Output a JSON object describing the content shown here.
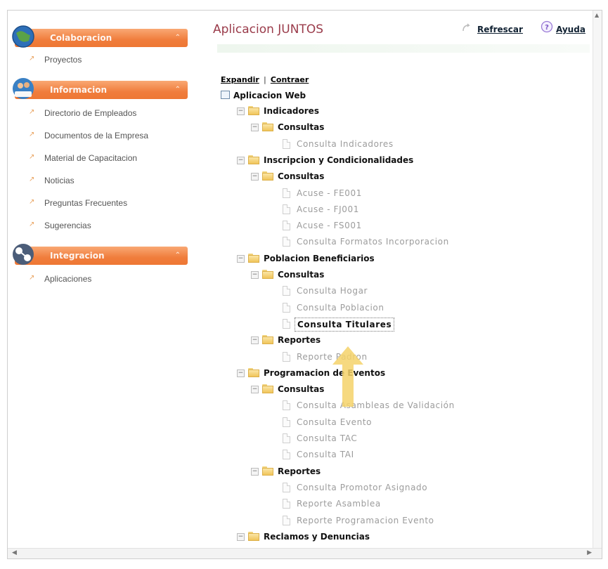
{
  "sidebar": {
    "sections": [
      {
        "label": "Colaboracion",
        "items": [
          "Proyectos"
        ]
      },
      {
        "label": "Informacion",
        "items": [
          "Directorio de Empleados",
          "Documentos de la Empresa",
          "Material de Capacitacion",
          "Noticias",
          "Preguntas Frecuentes",
          "Sugerencias"
        ]
      },
      {
        "label": "Integracion",
        "items": [
          "Aplicaciones"
        ]
      }
    ],
    "chevron": "⌃"
  },
  "header": {
    "title": "Aplicacion JUNTOS",
    "refresh_label": "Refrescar",
    "help_label": "Ayuda"
  },
  "tree_controls": {
    "expand_label": "Expandir",
    "separator": "|",
    "collapse_label": "Contraer"
  },
  "tree": {
    "root": "Aplicacion Web",
    "rows": [
      {
        "type": "folder",
        "level": 1,
        "label": "Indicadores"
      },
      {
        "type": "folder",
        "level": 2,
        "label": "Consultas"
      },
      {
        "type": "leaf",
        "level": 3,
        "label": "Consulta Indicadores"
      },
      {
        "type": "folder",
        "level": 1,
        "label": "Inscripcion y Condicionalidades"
      },
      {
        "type": "folder",
        "level": 2,
        "label": "Consultas"
      },
      {
        "type": "leaf",
        "level": 3,
        "label": "Acuse - FE001"
      },
      {
        "type": "leaf",
        "level": 3,
        "label": "Acuse - FJ001"
      },
      {
        "type": "leaf",
        "level": 3,
        "label": "Acuse - FS001"
      },
      {
        "type": "leaf",
        "level": 3,
        "label": "Consulta Formatos Incorporacion"
      },
      {
        "type": "folder",
        "level": 1,
        "label": "Poblacion Beneficiarios"
      },
      {
        "type": "folder",
        "level": 2,
        "label": "Consultas"
      },
      {
        "type": "leaf",
        "level": 3,
        "label": "Consulta Hogar"
      },
      {
        "type": "leaf",
        "level": 3,
        "label": "Consulta Poblacion"
      },
      {
        "type": "leaf",
        "level": 3,
        "label": "Consulta Titulares",
        "selected": true
      },
      {
        "type": "folder",
        "level": 2,
        "label": "Reportes"
      },
      {
        "type": "leaf",
        "level": 3,
        "label": "Reporte Padron"
      },
      {
        "type": "folder",
        "level": 1,
        "label": "Programacion de Eventos"
      },
      {
        "type": "folder",
        "level": 2,
        "label": "Consultas"
      },
      {
        "type": "leaf",
        "level": 3,
        "label": "Consulta Asambleas de Validación"
      },
      {
        "type": "leaf",
        "level": 3,
        "label": "Consulta Evento"
      },
      {
        "type": "leaf",
        "level": 3,
        "label": "Consulta TAC"
      },
      {
        "type": "leaf",
        "level": 3,
        "label": "Consulta TAI"
      },
      {
        "type": "folder",
        "level": 2,
        "label": "Reportes"
      },
      {
        "type": "leaf",
        "level": 3,
        "label": "Consulta Promotor Asignado"
      },
      {
        "type": "leaf",
        "level": 3,
        "label": "Reporte Asamblea"
      },
      {
        "type": "leaf",
        "level": 3,
        "label": "Reporte Programacion Evento"
      },
      {
        "type": "folder",
        "level": 1,
        "label": "Reclamos y Denuncias"
      }
    ],
    "toggle_symbol": "−"
  },
  "colors": {
    "section_header": "#f07d3c",
    "title": "#9a3b4a",
    "leaf_text": "#9c9c9c",
    "cursor": "#f5d36a"
  }
}
